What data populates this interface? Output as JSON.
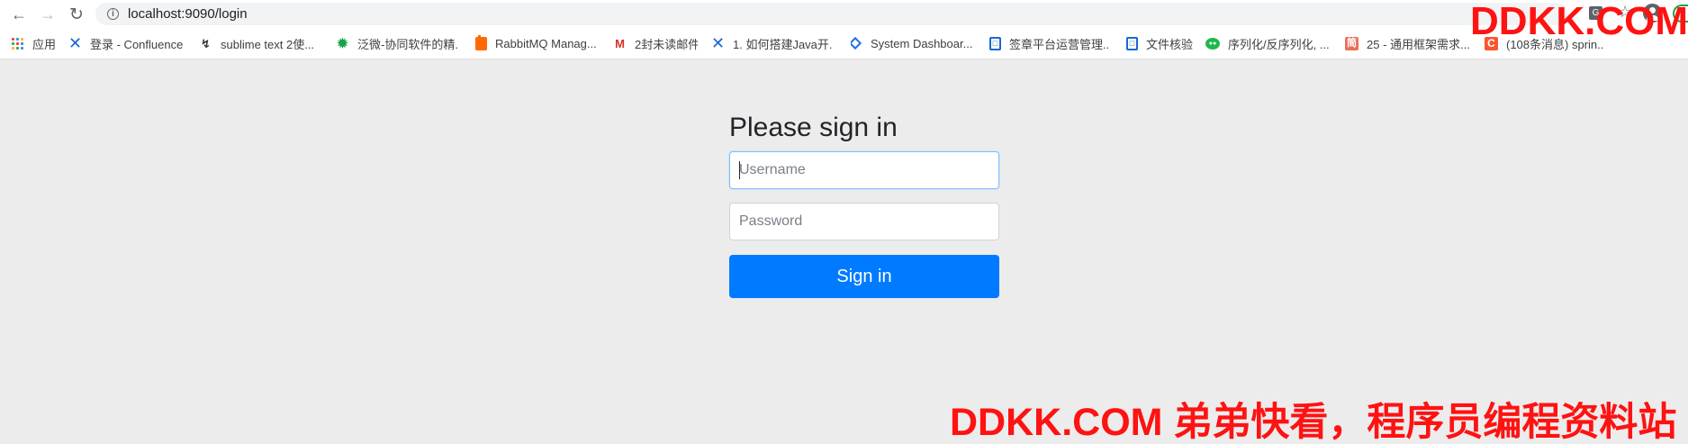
{
  "browser": {
    "back_icon": "arrow-left-icon",
    "forward_icon": "arrow-right-icon",
    "reload_icon": "reload-icon",
    "address_icon": "info-icon",
    "url": "localhost:9090/login",
    "translate_icon": "translate-icon",
    "star_icon": "star-icon",
    "profile_icon": "profile-icon"
  },
  "bookmarks": [
    {
      "label": "应用",
      "icon": "apps-icon"
    },
    {
      "label": "登录 - Confluence",
      "icon": "confluence-icon"
    },
    {
      "label": "sublime text 2使...",
      "icon": "sublime-icon"
    },
    {
      "label": "泛微-协同软件的精...",
      "icon": "green-gear-icon"
    },
    {
      "label": "RabbitMQ Manag...",
      "icon": "rabbitmq-icon"
    },
    {
      "label": "2封未读邮件",
      "icon": "gmail-icon"
    },
    {
      "label": "1. 如何搭建Java开...",
      "icon": "confluence-icon"
    },
    {
      "label": "System Dashboar...",
      "icon": "dashboard-icon"
    },
    {
      "label": "签章平台运营管理...",
      "icon": "document-icon"
    },
    {
      "label": "文件核验",
      "icon": "document-icon"
    },
    {
      "label": "序列化/反序列化, ...",
      "icon": "wechat-icon"
    },
    {
      "label": "25 - 通用框架需求...",
      "icon": "jianshu-icon"
    },
    {
      "label": "(108条消息) sprin...",
      "icon": "csdn-icon"
    }
  ],
  "login": {
    "title": "Please sign in",
    "username_placeholder": "Username",
    "password_placeholder": "Password",
    "sign_in_button": "Sign in"
  },
  "watermarks": {
    "top": "DDKK.COM",
    "bottom": "DDKK.COM 弟弟快看，程序员编程资料站"
  },
  "colors": {
    "page_background": "#ececec",
    "primary_button": "#007bff",
    "watermark": "#ff1212",
    "focused_border": "#80bdff"
  }
}
